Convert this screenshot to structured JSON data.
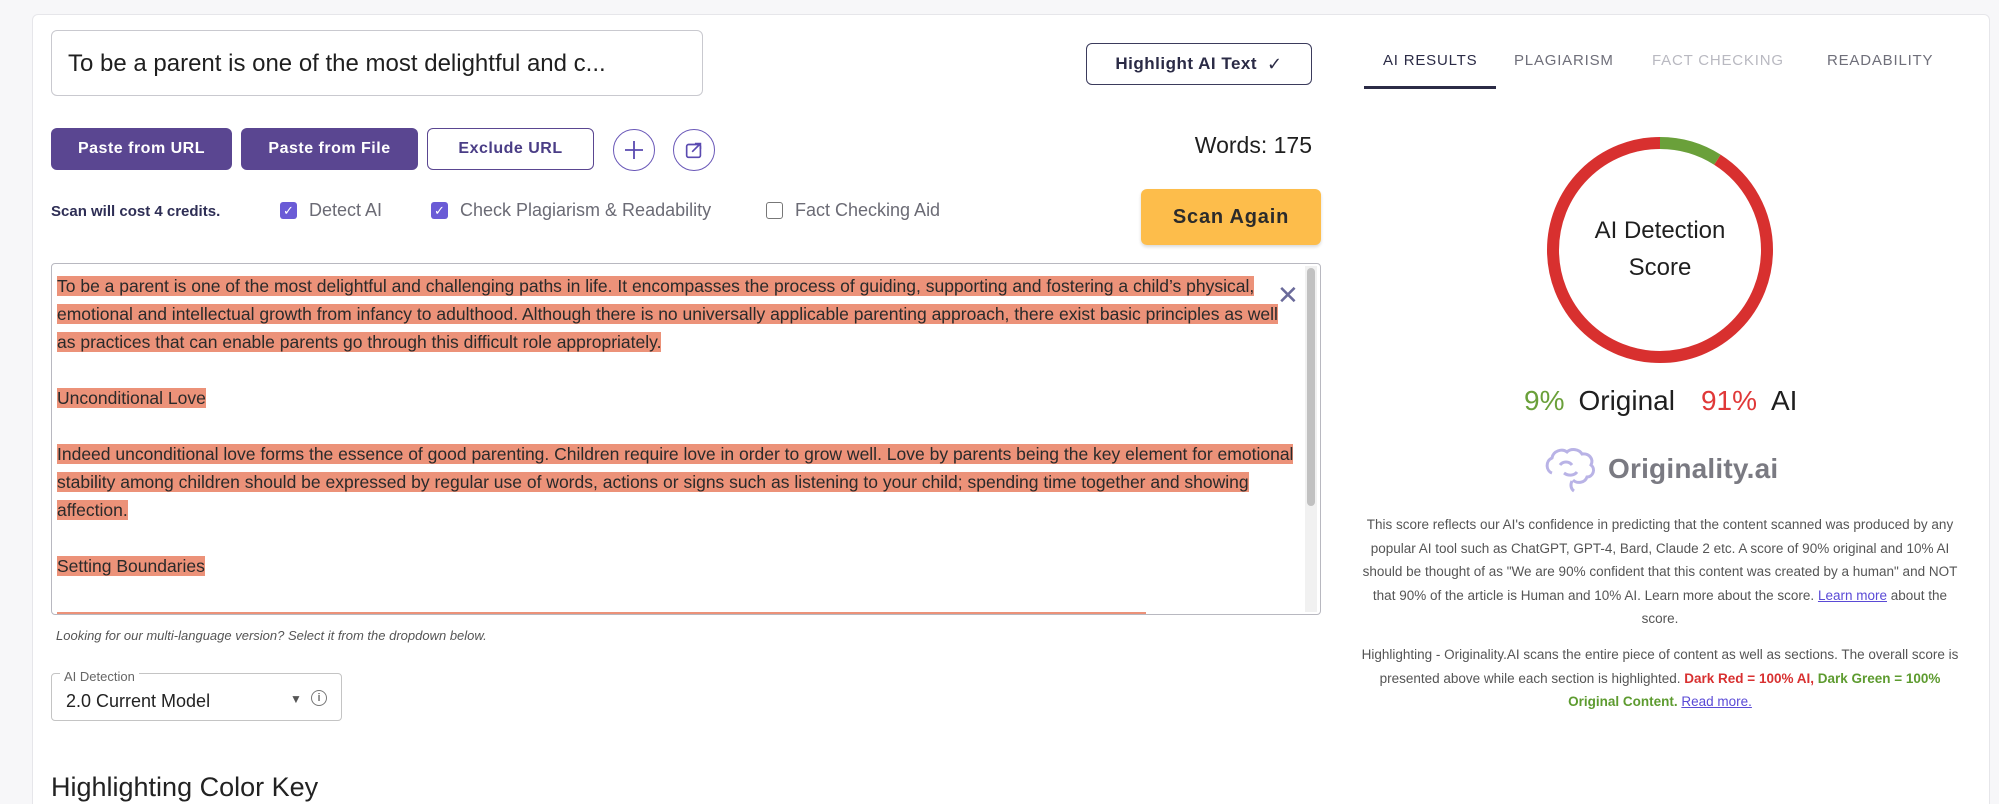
{
  "editor": {
    "title_value": "To be a parent is one of the most delightful and c...",
    "highlight_label": "Highlight AI Text",
    "paste_url_label": "Paste from URL",
    "paste_file_label": "Paste from File",
    "exclude_url_label": "Exclude URL",
    "words_label": "Words: 175",
    "cost_label": "Scan will cost 4 credits.",
    "options": [
      {
        "label": "Detect AI",
        "checked": true
      },
      {
        "label": "Check Plagiarism & Readability",
        "checked": true
      },
      {
        "label": "Fact Checking Aid",
        "checked": false
      }
    ],
    "scan_label": "Scan Again",
    "paragraphs": [
      "To be a parent is one of the most delightful and challenging paths in life. It encompasses the process of guiding, supporting and fostering a child’s physical, emotional and intellectual growth from infancy to adulthood. Although there is no universally applicable parenting approach, there exist basic principles as well as practices that can enable parents go through this difficult role appropriately.",
      "Unconditional Love",
      "Indeed unconditional love forms the essence of good parenting. Children require love in order to grow well. Love by parents being the key element for emotional stability among children should be expressed by regular use of words, actions or signs such as listening to your child; spending time together and showing affection.",
      "Setting Boundaries"
    ],
    "lang_note": "Looking for our multi-language version? Select it from the dropdown below.",
    "model_select": {
      "legend": "AI Detection",
      "value": "2.0 Current Model"
    },
    "color_key_heading": "Highlighting Color Key"
  },
  "results": {
    "tabs": [
      {
        "label": "AI RESULTS",
        "state": "active"
      },
      {
        "label": "PLAGIARISM",
        "state": "normal"
      },
      {
        "label": "FACT CHECKING",
        "state": "disabled"
      },
      {
        "label": "READABILITY",
        "state": "normal"
      }
    ],
    "donut_label_line1": "AI Detection",
    "donut_label_line2": "Score",
    "original_pct": 9,
    "ai_pct": 91,
    "original_pct_label": "9%",
    "original_label": "Original",
    "ai_pct_label": "91%",
    "ai_label": "AI",
    "colors": {
      "original": "#6aa03a",
      "ai": "#d8302f"
    },
    "logo_text": "Originality.ai",
    "description": "This score reflects our AI's confidence in predicting that the content scanned was produced by any popular AI tool such as ChatGPT, GPT-4, Bard, Claude 2 etc. A score of 90% original and 10% AI should be thought of as \"We are 90% confident that this content was created by a human\" and NOT that 90% of the article is Human and 10% AI. Learn more about the score.",
    "learn_more_link": "Learn more",
    "description_tail": "about the score.",
    "highlight_text": "Highlighting - Originality.AI scans the entire piece of content as well as sections. The overall score is presented above while each section is highlighted.",
    "dark_red_label": "Dark Red = 100% AI,",
    "dark_green_label": "Dark Green = 100% Original Content.",
    "read_more_link": "Read more."
  }
}
